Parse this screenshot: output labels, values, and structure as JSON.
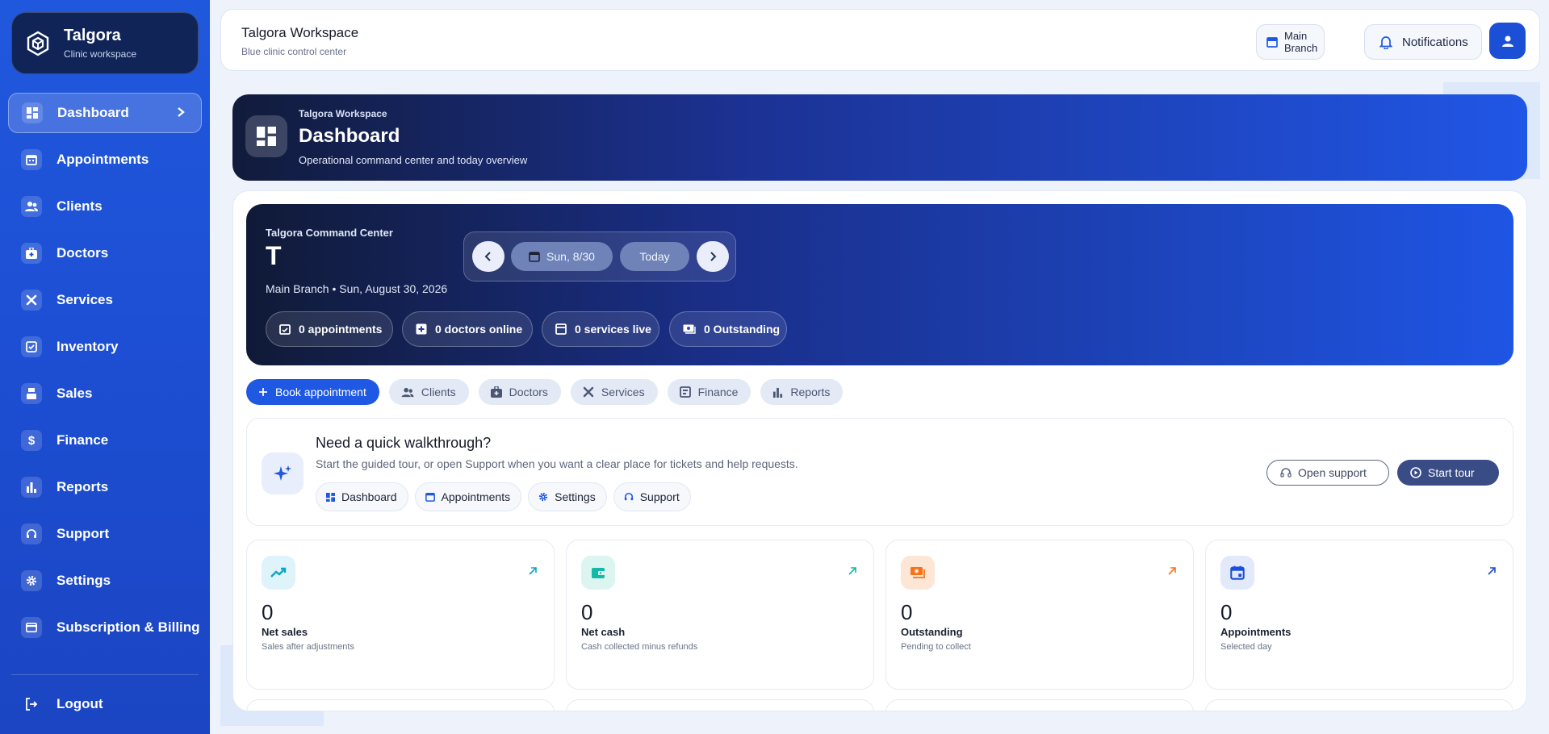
{
  "sidebar": {
    "brand": {
      "name": "Talgora",
      "subtitle": "Clinic workspace"
    },
    "items": [
      {
        "label": "Dashboard"
      },
      {
        "label": "Appointments"
      },
      {
        "label": "Clients"
      },
      {
        "label": "Doctors"
      },
      {
        "label": "Services"
      },
      {
        "label": "Inventory"
      },
      {
        "label": "Sales"
      },
      {
        "label": "Finance"
      },
      {
        "label": "Reports"
      },
      {
        "label": "Support"
      },
      {
        "label": "Settings"
      },
      {
        "label": "Subscription & Billing"
      }
    ],
    "logout": "Logout"
  },
  "topbar": {
    "title": "Talgora Workspace",
    "subtitle": "Blue clinic control center",
    "branch": "Main Branch",
    "notifications": "Notifications"
  },
  "hero": {
    "eyebrow": "Talgora Workspace",
    "title": "Dashboard",
    "subtitle": "Operational command center and today overview"
  },
  "command": {
    "eyebrow": "Talgora Command Center",
    "initial": "T",
    "subtitle": "Main Branch • Sun, August 30, 2026",
    "date_label": "Sun, 8/30",
    "today_label": "Today",
    "stats": [
      "0 appointments",
      "0 doctors online",
      "0 services live",
      "0 Outstanding"
    ]
  },
  "actions": [
    {
      "label": "Book appointment",
      "icon": "plus-icon"
    },
    {
      "label": "Clients",
      "icon": "clients-icon"
    },
    {
      "label": "Doctors",
      "icon": "doctors-icon"
    },
    {
      "label": "Services",
      "icon": "services-icon"
    },
    {
      "label": "Finance",
      "icon": "finance-icon"
    },
    {
      "label": "Reports",
      "icon": "reports-icon"
    }
  ],
  "walkthrough": {
    "title": "Need a quick walkthrough?",
    "subtitle": "Start the guided tour, or open Support when you want a clear place for tickets and help requests.",
    "chips": [
      "Dashboard",
      "Appointments",
      "Settings",
      "Support"
    ],
    "open_support": "Open support",
    "start_tour": "Start tour"
  },
  "kpis": [
    {
      "value": "0",
      "label": "Net sales",
      "sub": "Sales after adjustments",
      "color": "#0ea5c6"
    },
    {
      "value": "0",
      "label": "Net cash",
      "sub": "Cash collected minus refunds",
      "color": "#14b8a6"
    },
    {
      "value": "0",
      "label": "Outstanding",
      "sub": "Pending to collect",
      "color": "#f97316"
    },
    {
      "value": "0",
      "label": "Appointments",
      "sub": "Selected day",
      "color": "#1d4ed8"
    }
  ],
  "colors": {
    "accent": "#1f58e2",
    "sidebar": "#1d4fd4",
    "dark": "#111b3b"
  }
}
